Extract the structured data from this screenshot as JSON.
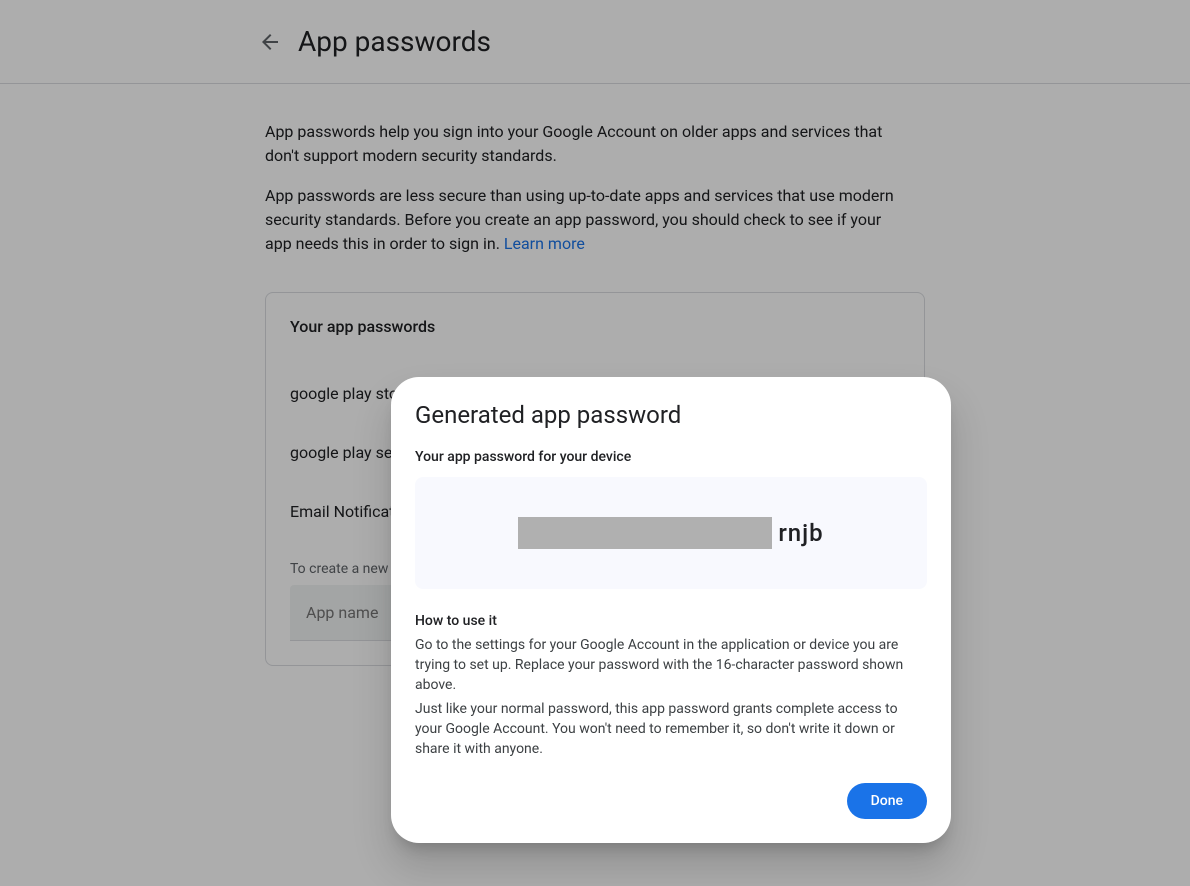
{
  "header": {
    "title": "App passwords"
  },
  "description": {
    "para1": "App passwords help you sign into your Google Account on older apps and services that don't support modern security standards.",
    "para2": "App passwords are less secure than using up-to-date apps and services that use modern security standards. Before you create an app password, you should check to see if your app needs this in order to sign in. ",
    "learn_more": "Learn more"
  },
  "card": {
    "title": "Your app passwords",
    "items": [
      "google play store",
      "google play services",
      "Email Notifications"
    ],
    "create_hint": "To create a new app specific password, type a name for it below...",
    "input_placeholder": "App name"
  },
  "modal": {
    "title": "Generated app password",
    "subtitle": "Your app password for your device",
    "password_visible": "rnjb",
    "how_title": "How to use it",
    "how_text1": "Go to the settings for your Google Account in the application or device you are trying to set up. Replace your password with the 16-character password shown above.",
    "how_text2": "Just like your normal password, this app password grants complete access to your Google Account. You won't need to remember it, so don't write it down or share it with anyone.",
    "done": "Done"
  }
}
